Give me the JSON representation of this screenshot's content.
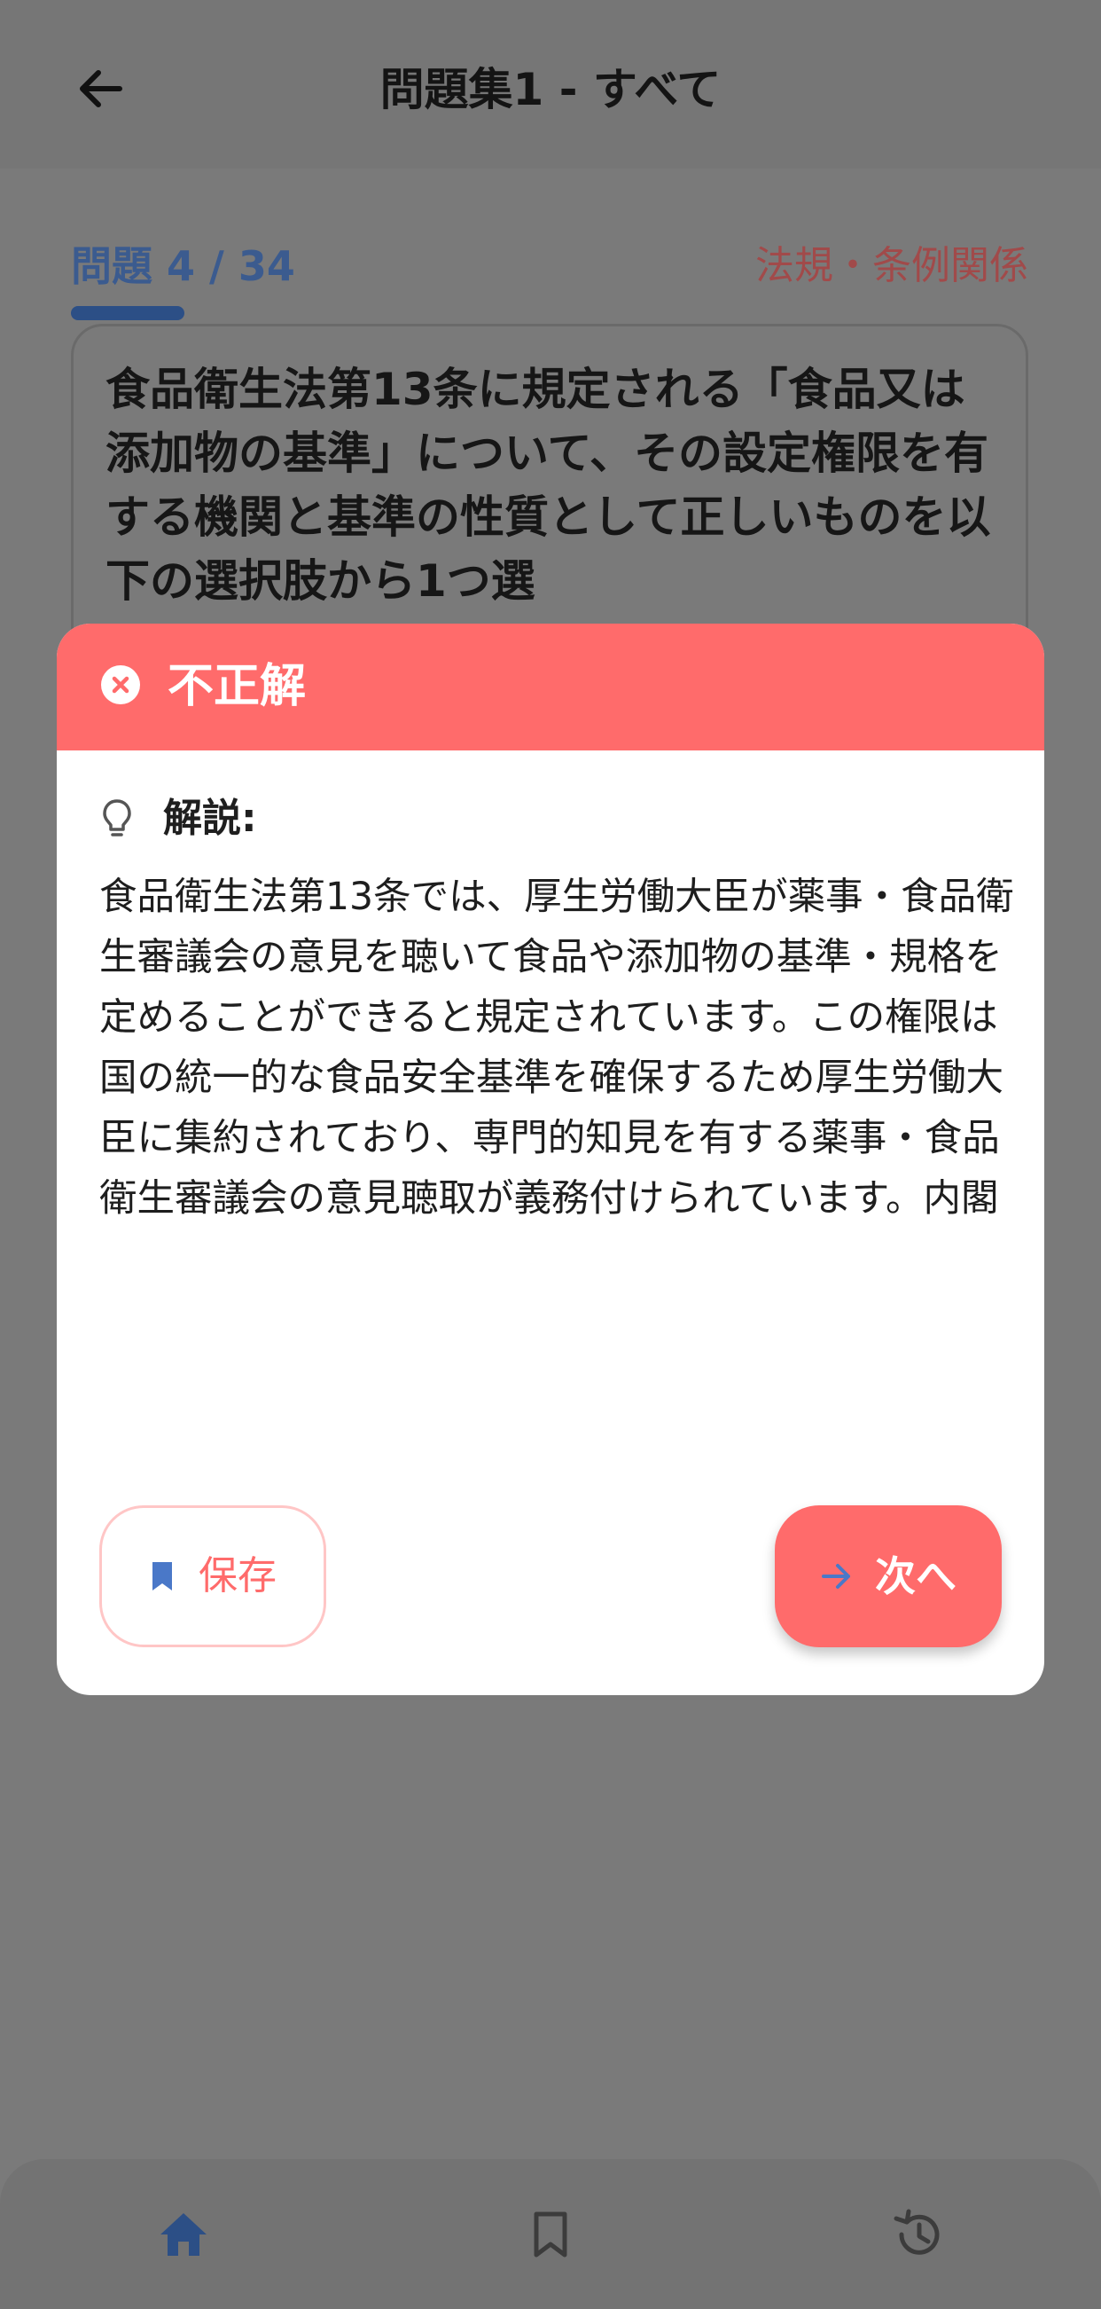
{
  "app_bar": {
    "title": "問題集1 - すべて",
    "back_icon": "arrow-left-icon"
  },
  "question": {
    "counter": "問題 4 / 34",
    "category": "法規・条例関係",
    "text": "食品衛生法第13条に規定される「食品又は添加物の基準」について、その設定権限を有する機関と基準の性質として正しいものを以下の選択肢から1つ選"
  },
  "result": {
    "icon": "close-circle-icon",
    "title": "不正解",
    "color": "#ff6b6b"
  },
  "explanation": {
    "icon": "lightbulb-icon",
    "label": "解説:",
    "text": "食品衛生法第13条では、厚生労働大臣が薬事・食品衛生審議会の意見を聴いて食品や添加物の基準・規格を定めることができると規定されています。この権限は国の統一的な食品安全基準を確保するため厚生労働大臣に集約されており、専門的知見を有する薬事・食品衛生審議会の意見聴取が義務付けられています。内閣総理大臣や都道府県知事にはこの権限はなく、また厚生労働大臣の独断ではなく審議会の意見聴取が必要です。この基準には製造基準、加工基準、保存基準等が含まれます。"
  },
  "actions": {
    "save_label": "保存",
    "save_icon": "bookmark-icon",
    "next_label": "次へ",
    "next_icon": "arrow-right-icon"
  },
  "bottom_nav": {
    "items": [
      {
        "icon": "home-icon",
        "active": true
      },
      {
        "icon": "bookmark-outline-icon",
        "active": false
      },
      {
        "icon": "history-icon",
        "active": false
      }
    ]
  },
  "colors": {
    "accent": "#ff6b6b",
    "primary_blue": "#4a78c8",
    "overlay": "#7a7a7a"
  }
}
